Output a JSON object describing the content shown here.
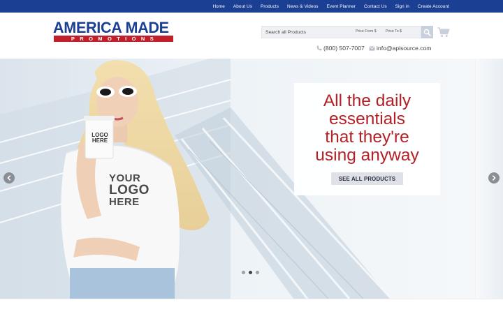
{
  "nav": {
    "items": [
      "Home",
      "About Us",
      "Products",
      "News & Videos",
      "Event Planner",
      "Contact Us",
      "Sign in",
      "Create Account"
    ]
  },
  "logo": {
    "line1": "AMERICA MADE",
    "line2": "PROMOTIONS"
  },
  "search": {
    "placeholder": "Search all Products",
    "price_from_placeholder": "Price From $",
    "price_to_placeholder": "Price To $"
  },
  "contact": {
    "phone": "(800) 507-7007",
    "email": "info@apisource.com"
  },
  "hero": {
    "headline": [
      "All the daily",
      "essentials",
      "that they're",
      "using anyway"
    ],
    "cta": "SEE ALL PRODUCTS",
    "shirt_text": [
      "YOUR",
      "LOGO",
      "HERE"
    ],
    "cup_text": [
      "LOGO",
      "HERE"
    ],
    "slide_count": 3,
    "active_slide": 2
  },
  "colors": {
    "nav_bg": "#1b3f92",
    "brand_blue": "#1b3f92",
    "brand_red": "#c1202a",
    "headline_red": "#b32126",
    "cta_bg": "#dfe1e7"
  },
  "icons": [
    "search-icon",
    "cart-icon",
    "phone-icon",
    "email-icon",
    "chevron-left-icon",
    "chevron-right-icon"
  ]
}
